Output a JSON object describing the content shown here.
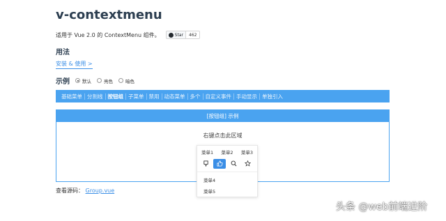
{
  "page": {
    "title": "v-contextmenu",
    "description": "适用于 Vue 2.0 的 ContextMenu 组件。",
    "github_star": {
      "label": "Star",
      "count": "462",
      "icon": "github-icon"
    }
  },
  "usage": {
    "heading": "用法",
    "install_link": "安装 & 使用 >"
  },
  "example": {
    "heading": "示例",
    "themes": [
      {
        "label": "默认",
        "selected": true
      },
      {
        "label": "亮色",
        "selected": false
      },
      {
        "label": "暗色",
        "selected": false
      }
    ],
    "tabs": [
      {
        "label": "基础菜单",
        "active": false
      },
      {
        "label": "分割线",
        "active": false
      },
      {
        "label": "按钮组",
        "active": true
      },
      {
        "label": "子菜单",
        "active": false
      },
      {
        "label": "禁用",
        "active": false
      },
      {
        "label": "动态菜单",
        "active": false
      },
      {
        "label": "多个",
        "active": false
      },
      {
        "label": "自定义事件",
        "active": false
      },
      {
        "label": "手动显示",
        "active": false
      },
      {
        "label": "单独引入",
        "active": false
      }
    ],
    "demo_title": "[按钮组] 示例",
    "demo_hint": "右键点击此区域"
  },
  "contextmenu": {
    "top_items": [
      "菜单1",
      "菜单2",
      "菜单3"
    ],
    "icon_buttons": [
      {
        "icon": "github-icon",
        "active": false
      },
      {
        "icon": "thumbs-up-icon",
        "active": true
      },
      {
        "icon": "search-icon",
        "active": false
      },
      {
        "icon": "star-icon",
        "active": false
      }
    ],
    "items": [
      "菜单4",
      "菜单5"
    ]
  },
  "source": {
    "label": "查看源码：",
    "link": "Group.vue"
  },
  "watermark": "头条 @web前端进阶",
  "colors": {
    "accent": "#4aa3f0",
    "link": "#3a8ee6"
  }
}
